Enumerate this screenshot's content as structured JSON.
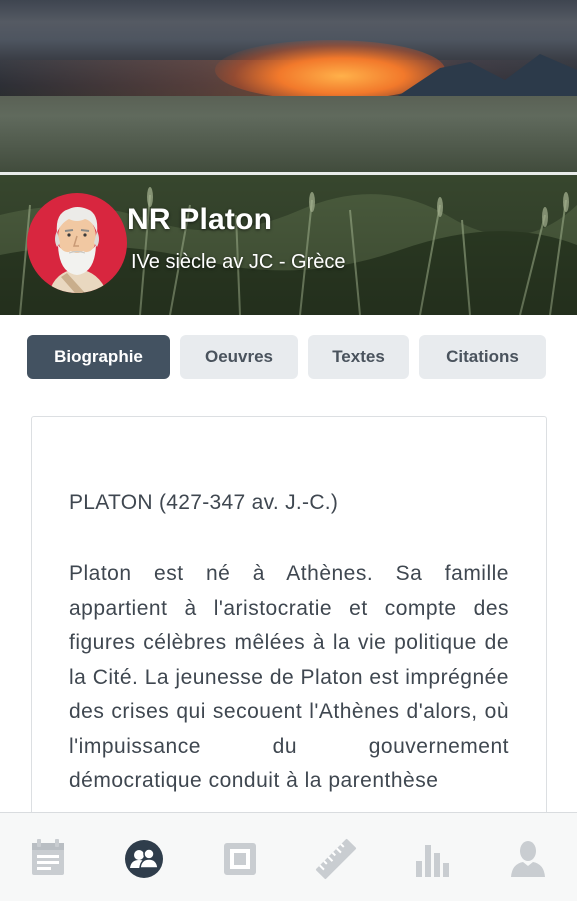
{
  "profile": {
    "name": "NR Platon",
    "subtitle": "IVe siècle av JC - Grèce",
    "avatar_color": "#d8263f"
  },
  "tabs": [
    {
      "label": "Biographie",
      "active": true
    },
    {
      "label": "Oeuvres",
      "active": false
    },
    {
      "label": "Textes",
      "active": false
    },
    {
      "label": "Citations",
      "active": false
    }
  ],
  "content": {
    "heading": "PLATON (427-347 av. J.-C.)",
    "body": "Platon est né à Athènes. Sa famille appartient à l'aristocratie et compte des figures célèbres mêlées à la vie politique de la Cité. La jeunesse de Platon est imprégnée des crises qui secouent l'Athènes d'alors, où l'impuissance du gouvernement démocratique conduit à la parenthèse"
  },
  "bottom_nav": [
    {
      "icon": "calendar-icon",
      "active": false
    },
    {
      "icon": "people-icon",
      "active": true
    },
    {
      "icon": "square-frame-icon",
      "active": false
    },
    {
      "icon": "ruler-icon",
      "active": false
    },
    {
      "icon": "bar-chart-icon",
      "active": false
    },
    {
      "icon": "user-icon",
      "active": false
    }
  ],
  "colors": {
    "tab_active_bg": "#435261",
    "tab_inactive_bg": "#e8ebee",
    "nav_active": "#2f3d4b",
    "nav_inactive": "#c9cdd1"
  }
}
